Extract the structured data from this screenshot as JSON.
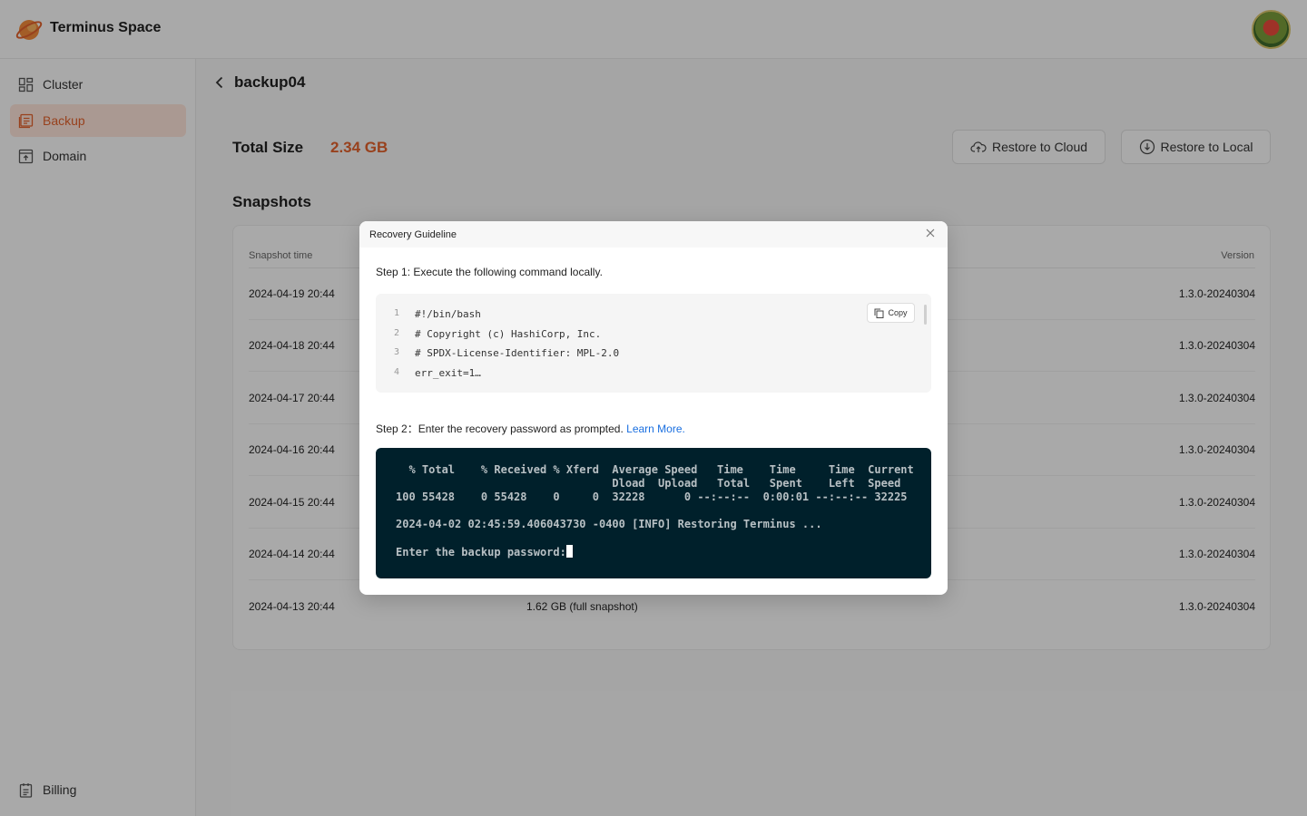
{
  "app": {
    "brand": "Terminus Space"
  },
  "sidebar": {
    "items": [
      {
        "label": "Cluster",
        "icon": "grid-icon"
      },
      {
        "label": "Backup",
        "icon": "backup-icon",
        "active": true
      },
      {
        "label": "Domain",
        "icon": "domain-icon"
      }
    ],
    "footer_item": {
      "label": "Billing",
      "icon": "billing-icon"
    }
  },
  "page": {
    "title": "backup04",
    "total_size_label": "Total Size",
    "total_size_value": "2.34 GB",
    "restore_cloud_label": "Restore to Cloud",
    "restore_local_label": "Restore to Local",
    "snapshots_title": "Snapshots"
  },
  "table": {
    "columns": [
      "Snapshot time",
      "Version"
    ],
    "rows": [
      {
        "time": "2024-04-19 20:44",
        "size": "",
        "version": "1.3.0-20240304"
      },
      {
        "time": "2024-04-18 20:44",
        "size": "",
        "version": "1.3.0-20240304"
      },
      {
        "time": "2024-04-17 20:44",
        "size": "",
        "version": "1.3.0-20240304"
      },
      {
        "time": "2024-04-16 20:44",
        "size": "",
        "version": "1.3.0-20240304"
      },
      {
        "time": "2024-04-15 20:44",
        "size": "",
        "version": "1.3.0-20240304"
      },
      {
        "time": "2024-04-14 20:44",
        "size": "",
        "version": "1.3.0-20240304"
      },
      {
        "time": "2024-04-13 20:44",
        "size": "1.62 GB (full snapshot)",
        "version": "1.3.0-20240304"
      }
    ]
  },
  "modal": {
    "title": "Recovery Guideline",
    "step1": "Step 1:  Execute the following command locally.",
    "copy_label": "Copy",
    "code_lines": [
      {
        "n": "1",
        "text": "#!/bin/bash"
      },
      {
        "n": "2",
        "text": "# Copyright (c) HashiCorp, Inc."
      },
      {
        "n": "3",
        "text": "# SPDX-License-Identifier: MPL-2.0"
      },
      {
        "n": "4",
        "text": "err_exit=1…"
      }
    ],
    "step2": "Step 2：Enter the recovery password as prompted.",
    "learn_more": "Learn More.",
    "terminal_lines": [
      "  % Total    % Received % Xferd  Average Speed   Time    Time     Time  Current",
      "                                 Dload  Upload   Total   Spent    Left  Speed",
      "100 55428    0 55428    0     0  32228      0 --:--:--  0:00:01 --:--:-- 32225",
      "2024-04-02 02:45:59.406043730 -0400 [INFO] Restoring Terminus ...",
      "Enter the backup password:"
    ]
  },
  "colors": {
    "accent": "#e0612c",
    "link": "#1a6fe0",
    "terminal_bg": "#00202b"
  }
}
